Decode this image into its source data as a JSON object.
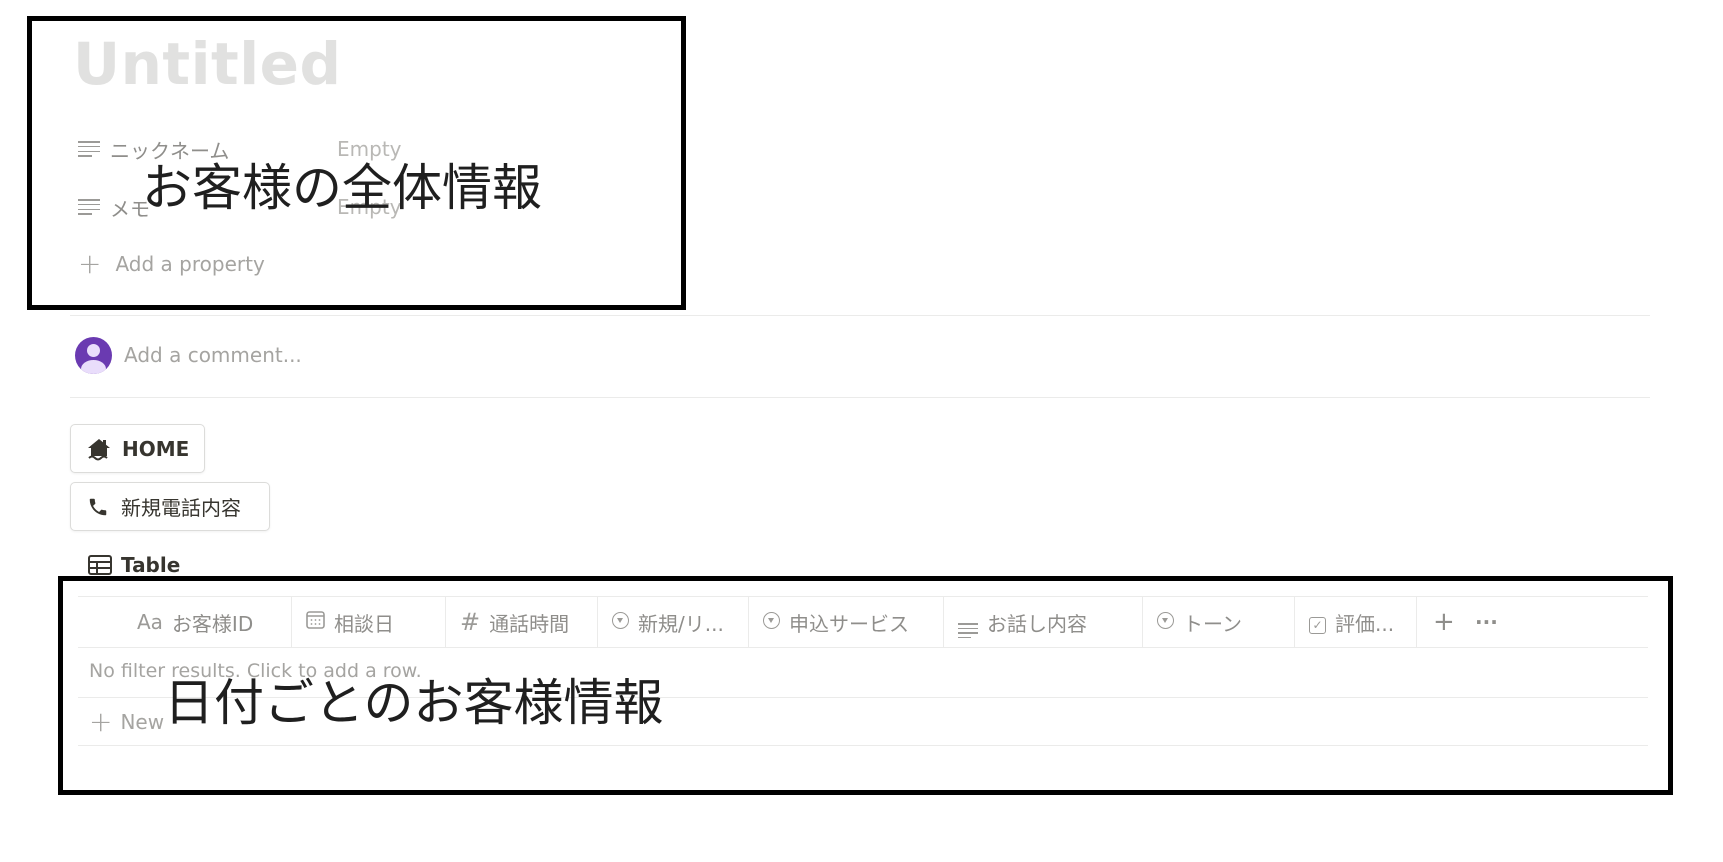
{
  "page": {
    "title": "Untitled"
  },
  "properties": [
    {
      "name": "ニックネーム",
      "value": "Empty",
      "icon": "text-lines-icon"
    },
    {
      "name": "メモ",
      "value": "Empty",
      "icon": "text-lines-icon"
    }
  ],
  "add_property_label": "Add a property",
  "comment": {
    "placeholder": "Add a comment..."
  },
  "buttons": {
    "home_label": "HOME",
    "home_icon": "home-icon",
    "new_call_label": "新規電話内容",
    "new_call_icon": "phone-icon"
  },
  "view": {
    "label": "Table",
    "icon": "table-icon"
  },
  "table": {
    "columns": [
      {
        "label": "お客様ID",
        "icon_text": "Aa"
      },
      {
        "label": "相談日",
        "icon": "calendar-icon"
      },
      {
        "label": "通話時間",
        "icon_text": "#"
      },
      {
        "label": "新規/リ...",
        "icon": "select-icon"
      },
      {
        "label": "申込サービス",
        "icon": "select-icon"
      },
      {
        "label": "お話し内容",
        "icon": "text-lines-icon"
      },
      {
        "label": "トーン",
        "icon": "select-icon"
      },
      {
        "label": "評価...",
        "icon": "checkbox-icon"
      }
    ],
    "add_column_label": "+",
    "more_label": "···",
    "empty_message": "No filter results. Click to add a row.",
    "new_label": "New"
  },
  "annotations": {
    "top_label": "お客様の全体情報",
    "bottom_label": "日付ごとのお客様情報"
  }
}
